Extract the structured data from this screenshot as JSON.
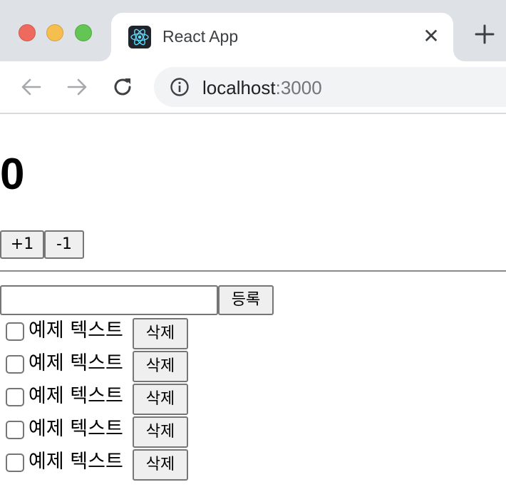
{
  "browser": {
    "tab_title": "React App",
    "tab_close_glyph": "✕",
    "url_host": "localhost",
    "url_port": ":3000"
  },
  "counter": {
    "value": "0",
    "increment_label": "+1",
    "decrement_label": "-1"
  },
  "todo_form": {
    "input_value": "",
    "submit_label": "등록"
  },
  "todos": [
    {
      "text": "예제 텍스트",
      "checked": false,
      "delete_label": "삭제"
    },
    {
      "text": "예제 텍스트",
      "checked": false,
      "delete_label": "삭제"
    },
    {
      "text": "예제 텍스트",
      "checked": false,
      "delete_label": "삭제"
    },
    {
      "text": "예제 텍스트",
      "checked": false,
      "delete_label": "삭제"
    },
    {
      "text": "예제 텍스트",
      "checked": false,
      "delete_label": "삭제"
    }
  ],
  "colors": {
    "tabstrip_bg": "#dee1e6",
    "omnibox_bg": "#f1f3f4",
    "react_blue": "#61dafb"
  }
}
